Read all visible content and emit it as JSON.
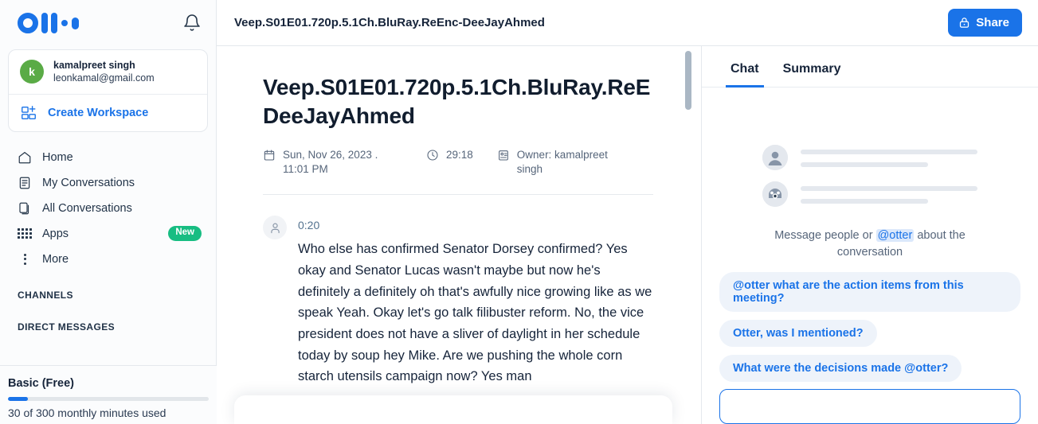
{
  "brand": {
    "logo_name": "otter-logo",
    "accent": "#1a73e8",
    "green": "#17bd82",
    "avatar_green": "#5aab46"
  },
  "sidebar": {
    "notification_icon": "bell-icon",
    "account": {
      "avatar_initial": "k",
      "name": "kamalpreet singh",
      "email": "leonkamal@gmail.com"
    },
    "create_workspace": {
      "icon": "add-workspace-icon",
      "label": "Create Workspace"
    },
    "nav": [
      {
        "icon": "home-icon",
        "label": "Home",
        "badge": ""
      },
      {
        "icon": "document-icon",
        "label": "My Conversations",
        "badge": ""
      },
      {
        "icon": "copy-icon",
        "label": "All Conversations",
        "badge": ""
      },
      {
        "icon": "grid-icon",
        "label": "Apps",
        "badge": "New"
      },
      {
        "icon": "more-vertical-icon",
        "label": "More",
        "badge": ""
      }
    ],
    "sections": [
      {
        "label": "CHANNELS"
      },
      {
        "label": "DIRECT MESSAGES"
      }
    ],
    "plan": {
      "name": "Basic (Free)",
      "usage_text": "30 of 300 monthly minutes used",
      "usage_percent": 10
    }
  },
  "topbar": {
    "title": "Veep.S01E01.720p.5.1Ch.BluRay.ReEnc-DeeJayAhmed",
    "share_label": "Share",
    "share_icon": "lock-icon"
  },
  "transcript": {
    "title": "Veep.S01E01.720p.5.1Ch.BluRay.ReE\nDeeJayAhmed",
    "meta": {
      "date_icon": "calendar-icon",
      "date": "Sun, Nov 26, 2023 . 11:01 PM",
      "duration_icon": "clock-icon",
      "duration": "29:18",
      "owner_icon": "id-badge-icon",
      "owner": "Owner: kamalpreet singh"
    },
    "utterances": [
      {
        "avatar_icon": "person-icon",
        "time": "0:20",
        "text": "Who else has confirmed Senator Dorsey confirmed? Yes okay and Senator Lucas wasn't maybe but now he's definitely a definitely oh that's awfully nice growing like as we speak Yeah. Okay let's go talk filibuster reform. No, the vice president does not have a sliver of daylight in her schedule today by soup hey Mike. Are we pushing the whole corn starch utensils campaign now? Yes man"
      }
    ]
  },
  "chat": {
    "tabs": [
      {
        "label": "Chat",
        "active": true
      },
      {
        "label": "Summary",
        "active": false
      }
    ],
    "hint_before": "Message people or ",
    "hint_mention": "@otter",
    "hint_after": " about the conversation",
    "suggestions": [
      "@otter what are the action items from this meeting?",
      "Otter, was I mentioned?",
      "What were the decisions made @otter?"
    ]
  }
}
